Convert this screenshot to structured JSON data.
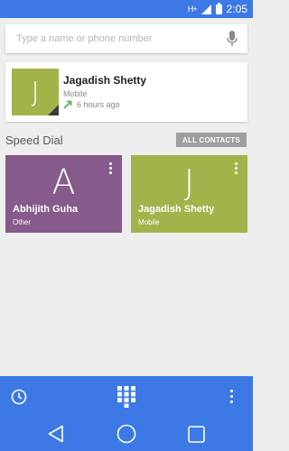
{
  "status_bar": {
    "signal": "H+",
    "time": "2:05"
  },
  "search": {
    "placeholder": "Type a name or phone number"
  },
  "recent_call": {
    "avatar_letter": "J",
    "name": "Jagadish Shetty",
    "type": "Mobile",
    "time": "6 hours ago"
  },
  "speed_dial": {
    "title": "Speed Dial",
    "all_contacts_label": "ALL CONTACTS",
    "contacts": [
      {
        "letter": "A",
        "name": "Abhijith Guha",
        "type": "Other",
        "color": "#865a8b"
      },
      {
        "letter": "J",
        "name": "Jagadish Shetty",
        "type": "Mobile",
        "color": "#a4b24a"
      }
    ]
  },
  "colors": {
    "accent": "#3d79e6",
    "recent_avatar": "#a4b24a",
    "outgoing_call": "#4caf50"
  },
  "icons": {
    "mic": "mic-icon",
    "history": "history-icon",
    "dialpad": "dialpad-icon",
    "overflow": "overflow-icon",
    "back": "back-icon",
    "home": "home-icon",
    "recents": "recent-apps-icon"
  }
}
